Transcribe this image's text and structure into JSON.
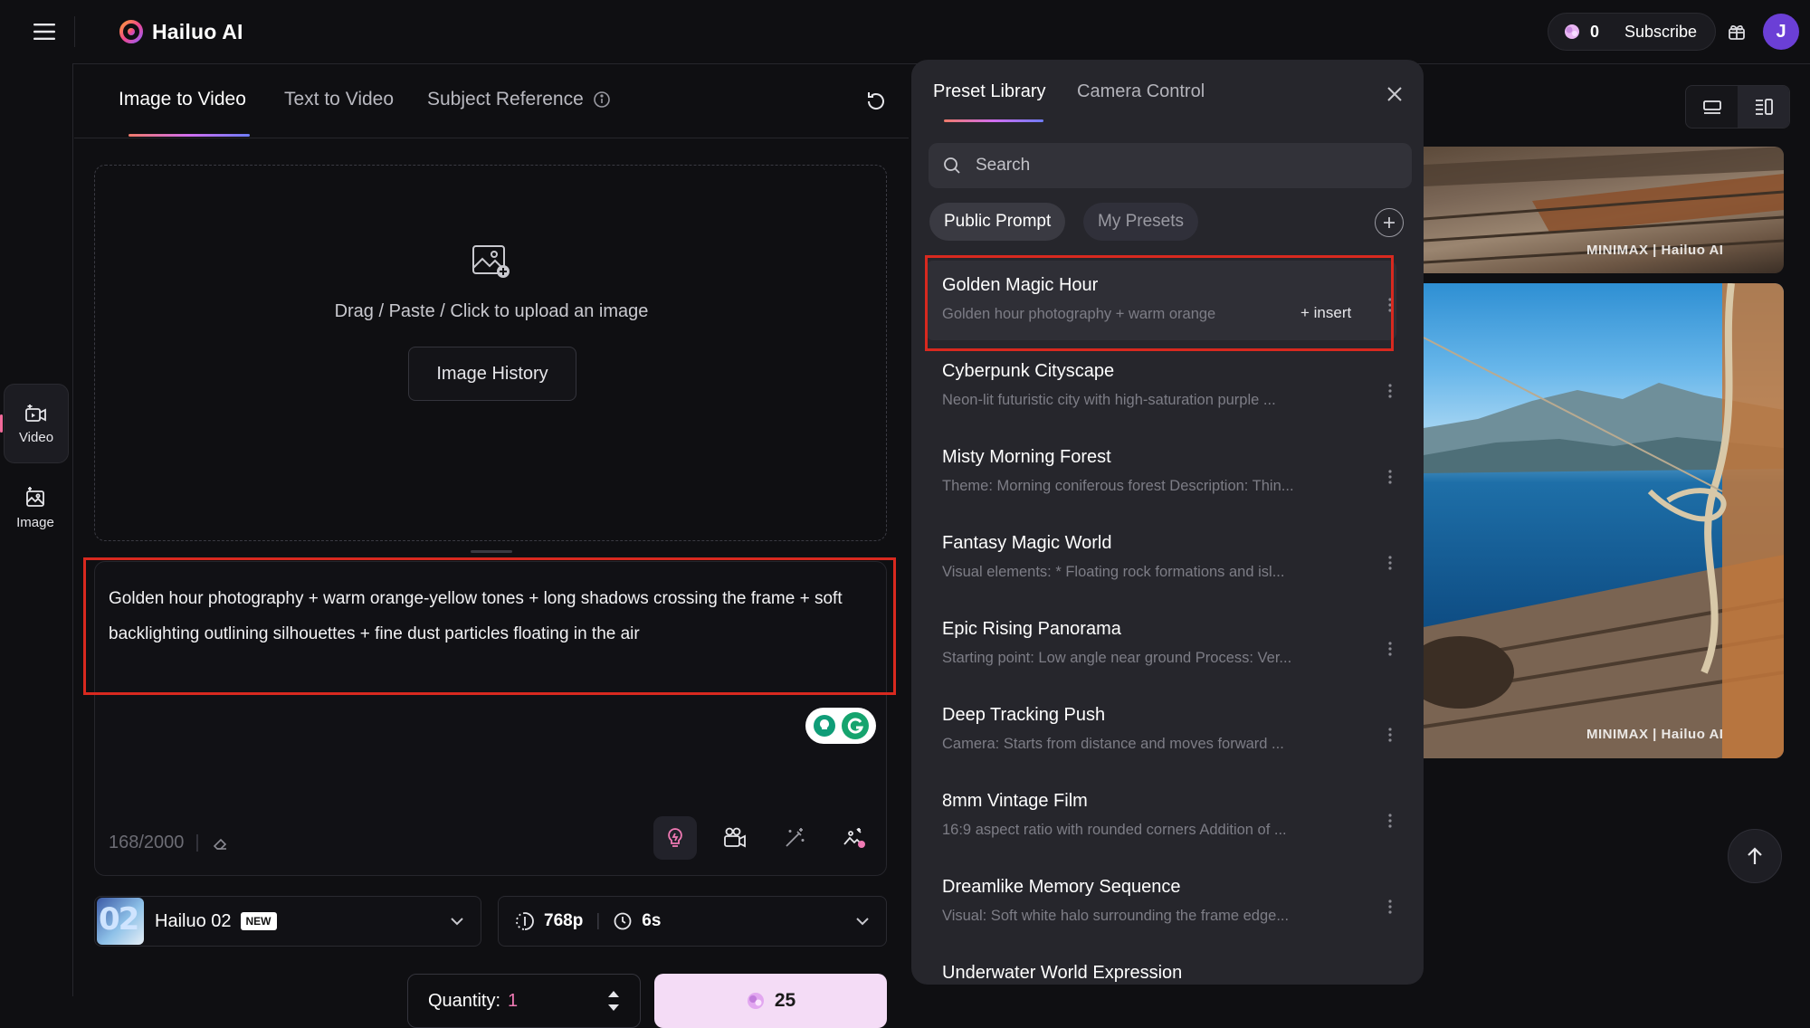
{
  "topbar": {
    "brand": "Hailuo AI",
    "credits": "0",
    "subscribe_label": "Subscribe",
    "avatar_initial": "J"
  },
  "leftrail": {
    "items": [
      {
        "label": "Video",
        "icon": "video-icon",
        "active": true
      },
      {
        "label": "Image",
        "icon": "image-icon",
        "active": false
      }
    ]
  },
  "main": {
    "tabs": [
      {
        "label": "Image to Video",
        "active": true
      },
      {
        "label": "Text to Video",
        "active": false
      },
      {
        "label": "Subject Reference",
        "active": false,
        "icon": "info-icon"
      }
    ],
    "upload": {
      "text": "Drag / Paste / Click to upload an image",
      "history_label": "Image History"
    },
    "prompt": {
      "value": "Golden hour photography + warm orange-yellow tones + long shadows crossing the frame + soft backlighting outlining silhouettes + fine dust particles floating in the air",
      "char_count": "168/2000"
    },
    "model": {
      "thumb_text": "02",
      "name": "Hailuo 02",
      "badge": "NEW"
    },
    "settings": {
      "resolution": "768p",
      "duration": "6s"
    },
    "quantity": {
      "label": "Quantity:",
      "value": "1"
    },
    "generate": {
      "cost": "25"
    }
  },
  "preset_panel": {
    "tabs": [
      {
        "label": "Preset Library",
        "active": true
      },
      {
        "label": "Camera Control",
        "active": false
      }
    ],
    "search_placeholder": "Search",
    "chips": [
      {
        "label": "Public Prompt",
        "active": true
      },
      {
        "label": "My Presets",
        "active": false
      }
    ],
    "insert_label": "+ insert",
    "items": [
      {
        "title": "Golden Magic Hour",
        "desc": "Golden hour photography + warm orange"
      },
      {
        "title": "Cyberpunk Cityscape",
        "desc": "Neon-lit futuristic city with high-saturation purple ..."
      },
      {
        "title": "Misty Morning Forest",
        "desc": "Theme: Morning coniferous forest Description: Thin..."
      },
      {
        "title": "Fantasy Magic World",
        "desc": "Visual elements: * Floating rock formations and isl..."
      },
      {
        "title": "Epic Rising Panorama",
        "desc": "Starting point: Low angle near ground Process: Ver..."
      },
      {
        "title": "Deep Tracking Push",
        "desc": "Camera: Starts from distance and moves forward ..."
      },
      {
        "title": "8mm Vintage Film",
        "desc": "16:9 aspect ratio with rounded corners Addition of ..."
      },
      {
        "title": "Dreamlike Memory Sequence",
        "desc": "Visual: Soft white halo surrounding the frame edge..."
      },
      {
        "title": "Underwater World Expression",
        "desc": ""
      }
    ]
  },
  "gallery": {
    "watermark": "MINIMAX | Hailuo AI"
  },
  "colors": {
    "accent_pink": "#f07ab4",
    "highlight_red": "#d8291f",
    "generate_bg": "#f4dcf6",
    "avatar_bg": "#6b3fd6"
  }
}
